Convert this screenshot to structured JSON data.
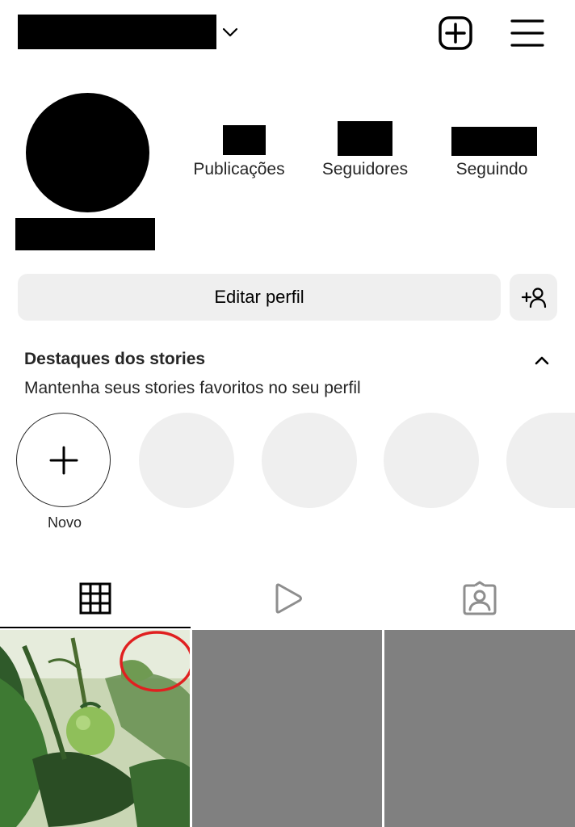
{
  "header": {
    "username_redacted": true,
    "menu_icon": "hamburger-icon",
    "create_icon": "plus-square-icon",
    "dropdown_icon": "chevron-down-icon"
  },
  "profile": {
    "stats": [
      {
        "label": "Publicações"
      },
      {
        "label": "Seguidores"
      },
      {
        "label": "Seguindo"
      }
    ]
  },
  "actions": {
    "edit_profile": "Editar perfil",
    "suggest_icon": "add-person-icon"
  },
  "highlights": {
    "title": "Destaques dos stories",
    "subtitle": "Mantenha seus stories favoritos no seu perfil",
    "new_label": "Novo",
    "collapse_icon": "chevron-up-icon"
  },
  "tabs": [
    {
      "name": "grid",
      "icon": "grid-icon",
      "active": true
    },
    {
      "name": "reels",
      "icon": "play-icon",
      "active": false
    },
    {
      "name": "tagged",
      "icon": "tagged-person-icon",
      "active": false
    }
  ],
  "colors": {
    "button_bg": "#efefef",
    "placeholder_tile": "#808080",
    "annotation_circle": "#e02020"
  }
}
